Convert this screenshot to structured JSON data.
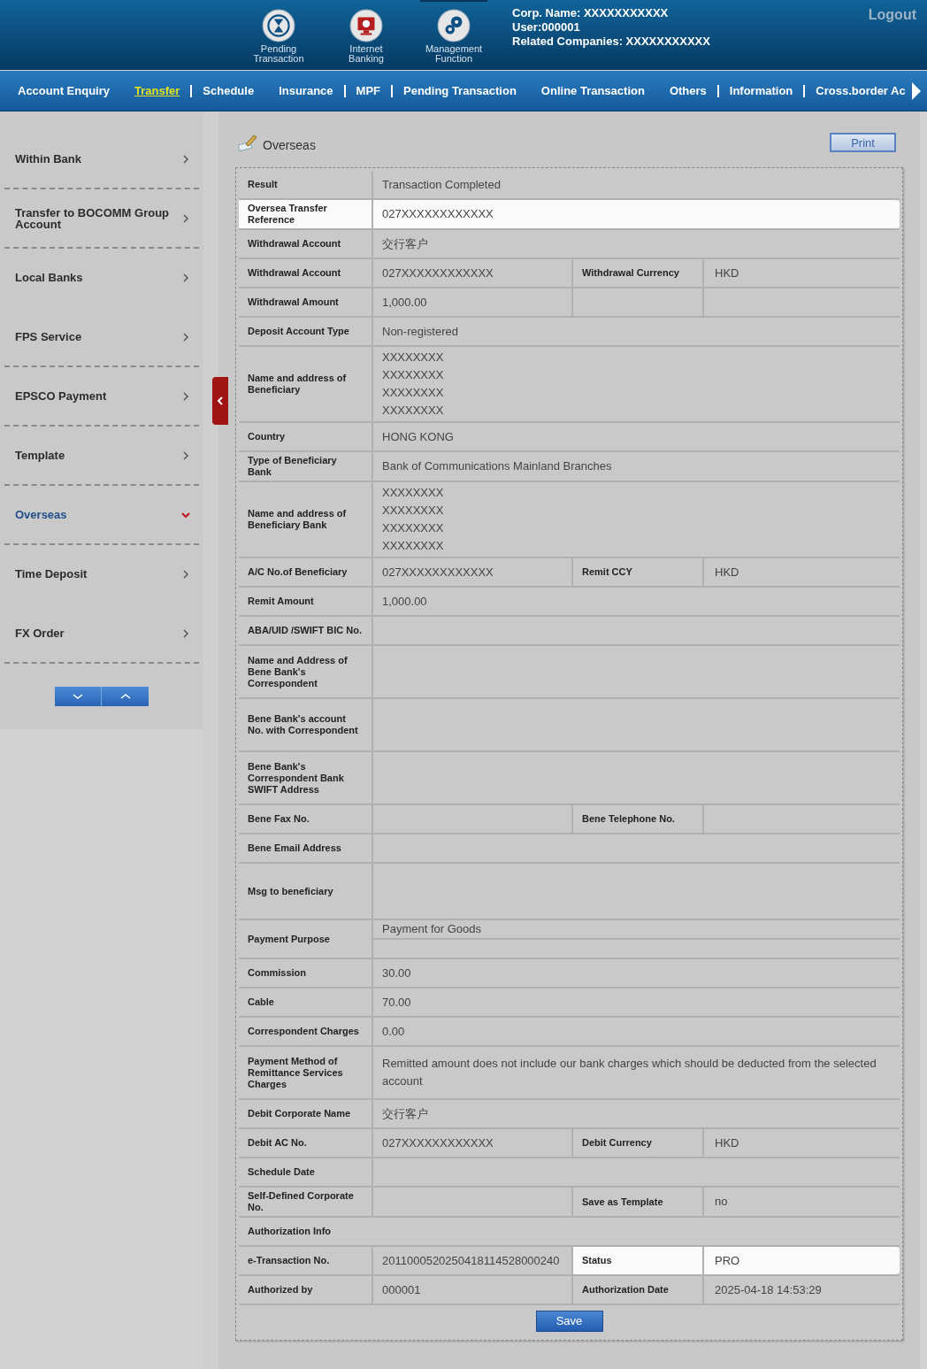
{
  "header": {
    "shortcuts": [
      {
        "label": "Pending Transaction",
        "selected": false
      },
      {
        "label": "Internet Banking",
        "selected": false
      },
      {
        "label": "Management Function",
        "selected": true
      }
    ],
    "corp_name": "Corp. Name: XXXXXXXXXXX",
    "user": "User:000001",
    "related": "Related Companies: XXXXXXXXXXX",
    "logout": "Logout"
  },
  "nav": [
    {
      "label": "Account Enquiry",
      "selected": false,
      "separator_after": false
    },
    {
      "label": "Transfer",
      "selected": true,
      "separator_after": true
    },
    {
      "label": "Schedule",
      "selected": false,
      "separator_after": false
    },
    {
      "label": "Insurance",
      "selected": false,
      "separator_after": true
    },
    {
      "label": "MPF",
      "selected": false,
      "separator_after": true
    },
    {
      "label": "Pending Transaction",
      "selected": false,
      "separator_after": false
    },
    {
      "label": "Online Transaction",
      "selected": false,
      "separator_after": false
    },
    {
      "label": "Others",
      "selected": false,
      "separator_after": true
    },
    {
      "label": "Information",
      "selected": false,
      "separator_after": true
    },
    {
      "label": "Cross.border Ac",
      "selected": false,
      "separator_after": false
    }
  ],
  "sidebar": {
    "items": [
      {
        "label": "Within Bank",
        "selected": false,
        "divider": true
      },
      {
        "label": "Transfer to BOCOMM Group Account",
        "selected": false,
        "divider": true
      },
      {
        "label": "Local Banks",
        "selected": false,
        "divider": false
      },
      {
        "label": "FPS Service",
        "selected": false,
        "divider": true
      },
      {
        "label": "EPSCO Payment",
        "selected": false,
        "divider": true
      },
      {
        "label": "Template",
        "selected": false,
        "divider": true
      },
      {
        "label": "Overseas",
        "selected": true,
        "divider": true
      },
      {
        "label": "Time Deposit",
        "selected": false,
        "divider": false
      },
      {
        "label": "FX Order",
        "selected": false,
        "divider": true
      }
    ]
  },
  "page": {
    "title": "Overseas",
    "print": "Print",
    "save": "Save"
  },
  "rows": [
    {
      "kind": "single",
      "label": "Result",
      "value": "Transaction Completed",
      "highlighted": false
    },
    {
      "kind": "single",
      "label": "Oversea Transfer Reference",
      "value": "027XXXXXXXXXXXX",
      "highlighted": true
    },
    {
      "kind": "single",
      "label": "Withdrawal Account",
      "value": "交行客户",
      "highlighted": false
    },
    {
      "kind": "pair",
      "label": "Withdrawal Account",
      "value": "027XXXXXXXXXXXX",
      "label2": "Withdrawal Currency",
      "value2": "HKD",
      "highlighted": false
    },
    {
      "kind": "pair",
      "label": "Withdrawal Amount",
      "value": "1,000.00",
      "highlighted": false
    },
    {
      "kind": "single",
      "label": "Deposit Account Type",
      "value": "Non-registered",
      "highlighted": false
    },
    {
      "kind": "lines",
      "label": "Name and address of Beneficiary",
      "lines": [
        "XXXXXXXX",
        "XXXXXXXX",
        "XXXXXXXX",
        "XXXXXXXX"
      ],
      "highlighted": false
    },
    {
      "kind": "single",
      "label": "Country",
      "value": "HONG KONG",
      "highlighted": false
    },
    {
      "kind": "single",
      "label": "Type of Beneficiary Bank",
      "value": "Bank of Communications Mainland Branches",
      "highlighted": false
    },
    {
      "kind": "lines",
      "label": "Name and address of Beneficiary Bank",
      "lines": [
        "XXXXXXXX",
        "XXXXXXXX",
        "XXXXXXXX",
        "XXXXXXXX"
      ],
      "highlighted": false
    },
    {
      "kind": "pair",
      "label": "A/C No.of Beneficiary",
      "value": "027XXXXXXXXXXXX",
      "label2": "Remit CCY",
      "value2": "HKD",
      "highlighted": false
    },
    {
      "kind": "single",
      "label": "Remit Amount",
      "value": "1,000.00",
      "highlighted": false
    },
    {
      "kind": "single",
      "label": "ABA/UID /SWIFT BIC No.",
      "highlighted": false
    },
    {
      "kind": "single",
      "label": "Name and Address of Bene Bank's Correspondent",
      "highlighted": false
    },
    {
      "kind": "single",
      "label": "Bene Bank's account No. with Correspondent",
      "highlighted": false
    },
    {
      "kind": "single",
      "label": "Bene Bank's Correspondent Bank SWIFT Address",
      "highlighted": false
    },
    {
      "kind": "pair",
      "label": "Bene Fax No.",
      "label2": "Bene Telephone No.",
      "highlighted": false
    },
    {
      "kind": "single",
      "label": "Bene Email Address",
      "highlighted": false
    },
    {
      "kind": "tall",
      "label": "Msg to beneficiary",
      "highlighted": false
    },
    {
      "kind": "split",
      "label": "Payment Purpose",
      "value": "Payment for Goods",
      "highlighted": false
    },
    {
      "kind": "single",
      "label": "Commission",
      "value": "30.00",
      "highlighted": false
    },
    {
      "kind": "single",
      "label": "Cable",
      "value": "70.00",
      "highlighted": false
    },
    {
      "kind": "single",
      "label": "Correspondent Charges",
      "value": "0.00",
      "highlighted": false
    },
    {
      "kind": "single",
      "label": "Payment Method of Remittance Services Charges",
      "value": "Remitted amount does not include our bank charges which should be deducted from the selected account",
      "highlighted": false
    },
    {
      "kind": "single",
      "label": "Debit Corporate Name",
      "value": "交行客户",
      "highlighted": false
    },
    {
      "kind": "pair",
      "label": "Debit AC No.",
      "value": "027XXXXXXXXXXXX",
      "label2": "Debit Currency",
      "value2": "HKD",
      "highlighted": false
    },
    {
      "kind": "single",
      "label": "Schedule Date",
      "highlighted": false
    },
    {
      "kind": "pair",
      "label": "Self-Defined Corporate No.",
      "label2": "Save as Template",
      "value2": "no",
      "highlighted": false
    },
    {
      "kind": "section",
      "label": "Authorization Info"
    },
    {
      "kind": "pair",
      "label": "e-Transaction No.",
      "value": "2011000520250418114528000240",
      "label2": "Status",
      "value2": "PRO",
      "highlighted": true
    },
    {
      "kind": "pair",
      "label": "Authorized by",
      "value": "000001",
      "label2": "Authorization Date",
      "value2": "2025-04-18 14:53:29",
      "highlighted": false
    }
  ]
}
